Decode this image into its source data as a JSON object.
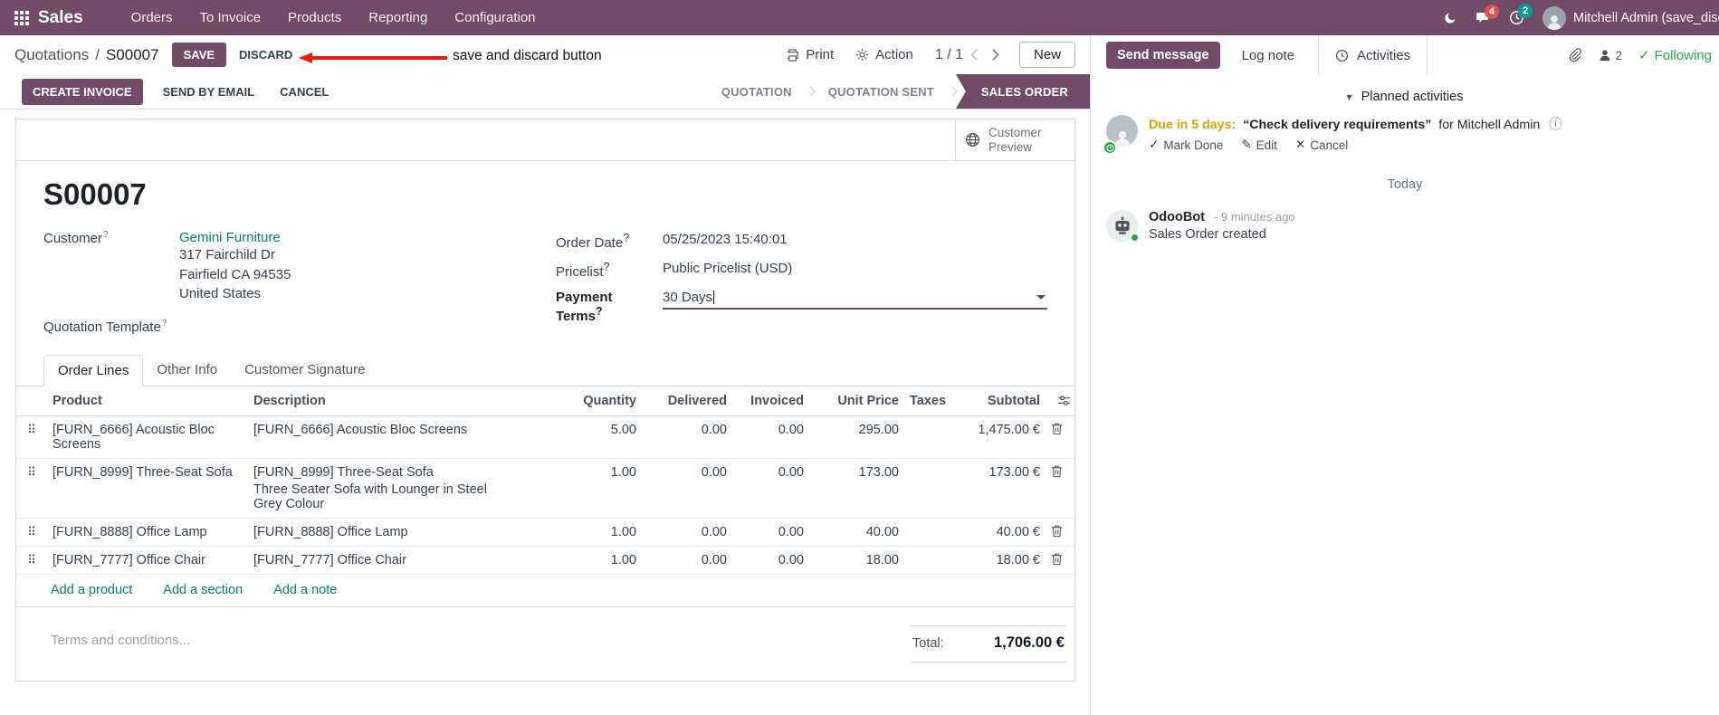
{
  "colors": {
    "brand": "#714B67",
    "link": "#017E84",
    "highlight_blue": "#2B6CB8",
    "due_orange": "#D9A300",
    "success_green": "#28A745",
    "annotation_red": "#EA1B0D"
  },
  "icons": {
    "drag": "⠿",
    "check": "✓",
    "edit": "✎",
    "cancel": "✕",
    "info": "ⓘ",
    "caret_down": "▾"
  },
  "topbar": {
    "app": "Sales",
    "menus": [
      "Orders",
      "To Invoice",
      "Products",
      "Reporting",
      "Configuration"
    ],
    "badges": {
      "chat": "4",
      "clock": "2"
    },
    "user": "Mitchell Admin (save_discar"
  },
  "breadcrumb": {
    "parent": "Quotations",
    "sep": "/",
    "current": "S00007",
    "save": "SAVE",
    "discard": "DISCARD"
  },
  "annotation": {
    "text": "save and discard button"
  },
  "actions": {
    "print": "Print",
    "action": "Action",
    "pager": "1 / 1",
    "new": "New"
  },
  "statusbar": {
    "primary": "CREATE INVOICE",
    "secondary": [
      "SEND BY EMAIL",
      "CANCEL"
    ],
    "steps": [
      "QUOTATION",
      "QUOTATION SENT",
      "SALES ORDER"
    ]
  },
  "form": {
    "preview": "Customer Preview",
    "title": "S00007",
    "help": "?",
    "customer_label": "Customer",
    "customer_name": "Gemini Furniture",
    "address": [
      "317 Fairchild Dr",
      "Fairfield CA 94535",
      "United States"
    ],
    "template_label": "Quotation Template",
    "order_date_label": "Order Date",
    "order_date": "05/25/2023 15:40:01",
    "pricelist_label": "Pricelist",
    "pricelist": "Public Pricelist (USD)",
    "payment_terms_label": "Payment Terms",
    "payment_terms": "30 Days",
    "tabs": [
      "Order Lines",
      "Other Info",
      "Customer Signature"
    ],
    "table": {
      "headers": [
        "Product",
        "Description",
        "Quantity",
        "Delivered",
        "Invoiced",
        "Unit Price",
        "Taxes",
        "Subtotal"
      ],
      "rows": [
        {
          "product": "[FURN_6666] Acoustic Bloc Screens",
          "desc": "[FURN_6666] Acoustic Bloc Screens",
          "qty": "5.00",
          "delivered": "0.00",
          "invoiced": "0.00",
          "price": "295.00",
          "taxes": "",
          "subtotal": "1,475.00 €"
        },
        {
          "product": "[FURN_8999] Three-Seat Sofa",
          "desc": "[FURN_8999] Three-Seat Sofa",
          "desc2": "Three Seater Sofa with Lounger in Steel Grey Colour",
          "qty": "1.00",
          "delivered": "0.00",
          "invoiced": "0.00",
          "price": "173.00",
          "taxes": "",
          "subtotal": "173.00 €"
        },
        {
          "product": "[FURN_8888] Office Lamp",
          "desc": "[FURN_8888] Office Lamp",
          "qty": "1.00",
          "delivered": "0.00",
          "invoiced": "0.00",
          "price": "40.00",
          "taxes": "",
          "subtotal": "40.00 €"
        },
        {
          "product": "[FURN_7777] Office Chair",
          "desc": "[FURN_7777] Office Chair",
          "qty": "1.00",
          "delivered": "0.00",
          "invoiced": "0.00",
          "price": "18.00",
          "taxes": "",
          "subtotal": "18.00 €"
        }
      ],
      "links": [
        "Add a product",
        "Add a section",
        "Add a note"
      ]
    },
    "terms_placeholder": "Terms and conditions...",
    "total_label": "Total:",
    "total": "1,706.00 €"
  },
  "chatter": {
    "send_message": "Send message",
    "log_note": "Log note",
    "activities": "Activities",
    "followers": "2",
    "following": "Following",
    "planned_title": "Planned activities",
    "activity": {
      "due": "Due in 5 days:",
      "summary": "“Check delivery requirements”",
      "assignee": "for Mitchell Admin",
      "mark_done": "Mark Done",
      "edit": "Edit",
      "cancel": "Cancel"
    },
    "today": "Today",
    "message": {
      "author": "OdooBot",
      "time": "- 9 minutes ago",
      "body": "Sales Order created"
    }
  }
}
